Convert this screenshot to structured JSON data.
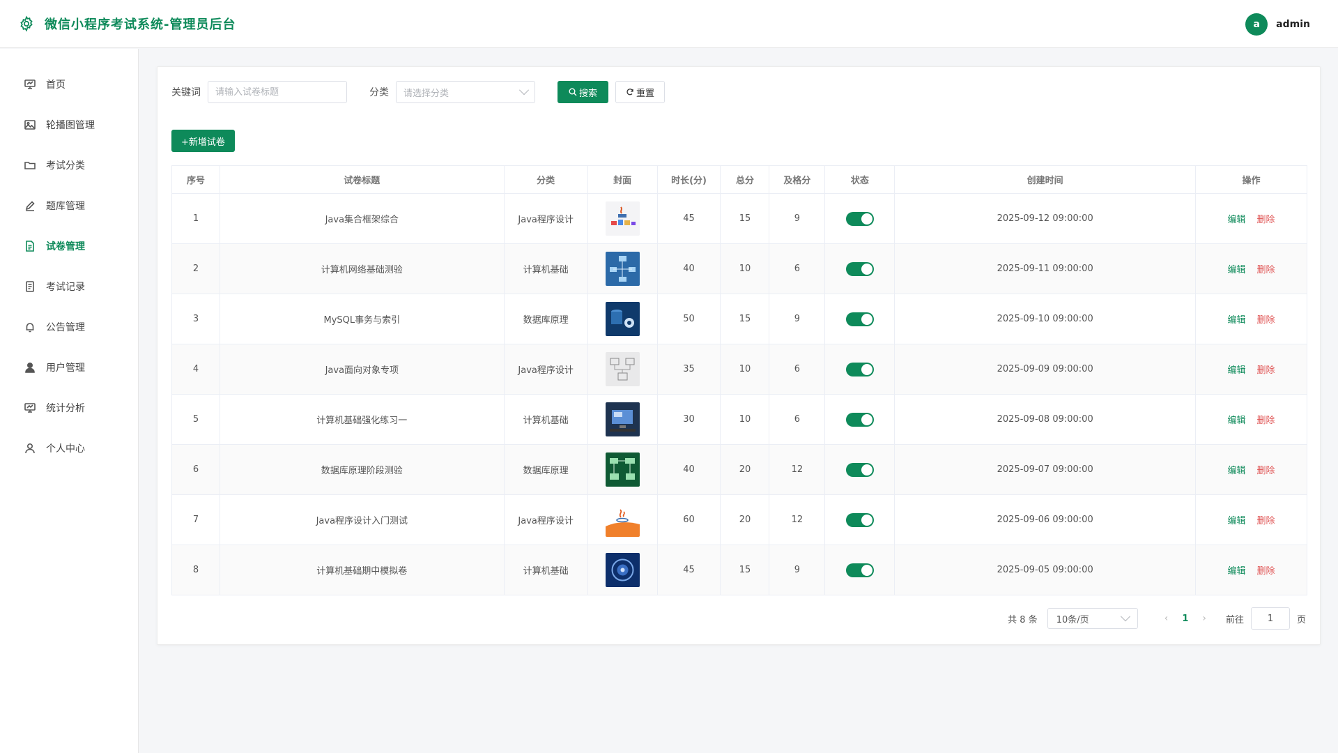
{
  "header": {
    "title": "微信小程序考试系统-管理员后台",
    "avatar_letter": "a",
    "username": "admin",
    "accent": "#0e8a5a"
  },
  "sidebar": {
    "items": [
      {
        "label": "首页",
        "icon": "monitor-icon"
      },
      {
        "label": "轮播图管理",
        "icon": "image-icon"
      },
      {
        "label": "考试分类",
        "icon": "folder-icon"
      },
      {
        "label": "题库管理",
        "icon": "edit-icon"
      },
      {
        "label": "试卷管理",
        "icon": "document-icon",
        "active": true
      },
      {
        "label": "考试记录",
        "icon": "record-icon"
      },
      {
        "label": "公告管理",
        "icon": "bell-icon"
      },
      {
        "label": "用户管理",
        "icon": "user-solid-icon"
      },
      {
        "label": "统计分析",
        "icon": "chart-icon"
      },
      {
        "label": "个人中心",
        "icon": "user-icon"
      }
    ]
  },
  "filter": {
    "keyword_label": "关键词",
    "keyword_placeholder": "请输入试卷标题",
    "category_label": "分类",
    "category_placeholder": "请选择分类",
    "search_label": "搜索",
    "reset_label": "重置"
  },
  "add_button_label": "+新增试卷",
  "table": {
    "columns": [
      "序号",
      "试卷标题",
      "分类",
      "封面",
      "时长(分)",
      "总分",
      "及格分",
      "状态",
      "创建时间",
      "操作"
    ],
    "edit_label": "编辑",
    "delete_label": "删除",
    "rows": [
      {
        "index": "1",
        "title": "Java集合框架综合",
        "category": "Java程序设计",
        "duration": "45",
        "total": "15",
        "pass": "9",
        "status_on": true,
        "created": "2025-09-12 09:00:00",
        "cover": "java-collections-cover"
      },
      {
        "index": "2",
        "title": "计算机网络基础测验",
        "category": "计算机基础",
        "duration": "40",
        "total": "10",
        "pass": "6",
        "status_on": true,
        "created": "2025-09-11 09:00:00",
        "cover": "network-cover"
      },
      {
        "index": "3",
        "title": "MySQL事务与索引",
        "category": "数据库原理",
        "duration": "50",
        "total": "15",
        "pass": "9",
        "status_on": true,
        "created": "2025-09-10 09:00:00",
        "cover": "mysql-cover"
      },
      {
        "index": "4",
        "title": "Java面向对象专项",
        "category": "Java程序设计",
        "duration": "35",
        "total": "10",
        "pass": "6",
        "status_on": true,
        "created": "2025-09-09 09:00:00",
        "cover": "uml-cover"
      },
      {
        "index": "5",
        "title": "计算机基础强化练习一",
        "category": "计算机基础",
        "duration": "30",
        "total": "10",
        "pass": "6",
        "status_on": true,
        "created": "2025-09-08 09:00:00",
        "cover": "desktop-cover"
      },
      {
        "index": "6",
        "title": "数据库原理阶段测验",
        "category": "数据库原理",
        "duration": "40",
        "total": "20",
        "pass": "12",
        "status_on": true,
        "created": "2025-09-07 09:00:00",
        "cover": "er-diagram-cover"
      },
      {
        "index": "7",
        "title": "Java程序设计入门测试",
        "category": "Java程序设计",
        "duration": "60",
        "total": "20",
        "pass": "12",
        "status_on": true,
        "created": "2025-09-06 09:00:00",
        "cover": "java-logo-cover"
      },
      {
        "index": "8",
        "title": "计算机基础期中模拟卷",
        "category": "计算机基础",
        "duration": "45",
        "total": "15",
        "pass": "9",
        "status_on": true,
        "created": "2025-09-05 09:00:00",
        "cover": "disk-cover"
      }
    ]
  },
  "pager": {
    "total_text": "共 8 条",
    "page_size": "10条/页",
    "current_page": "1",
    "goto_label": "前往",
    "goto_value": "1",
    "page_suffix": "页"
  }
}
